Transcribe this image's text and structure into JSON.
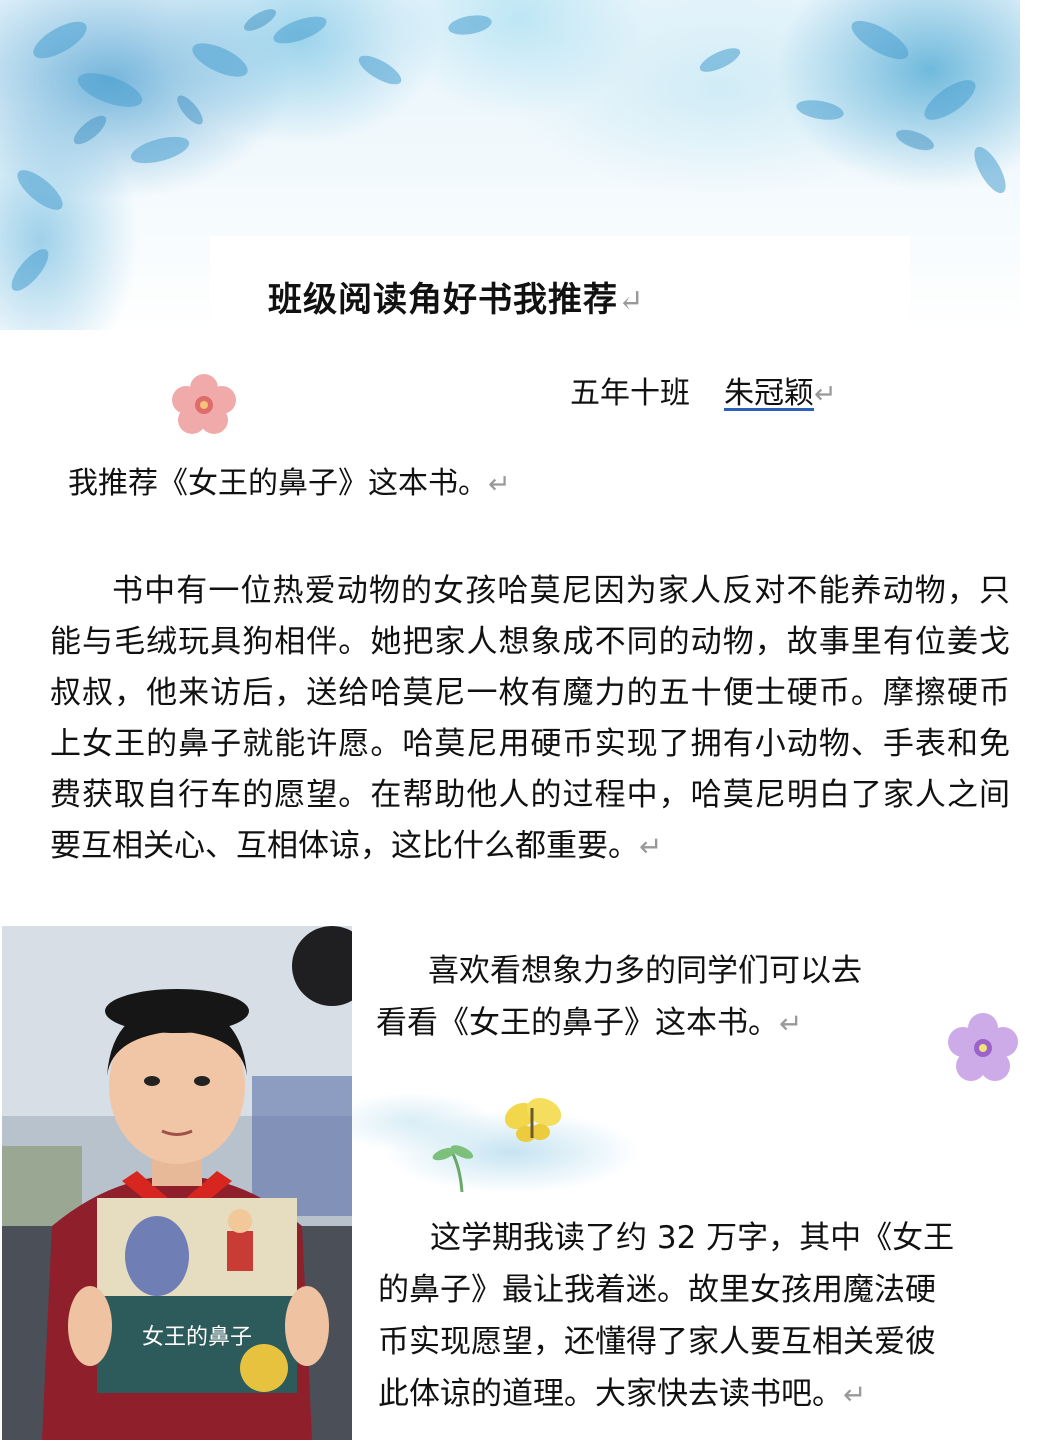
{
  "title": "班级阅读角好书我推荐",
  "return_mark": "↵",
  "author": {
    "class": "五年十班",
    "name": "朱冠颖"
  },
  "recommend_line": "我推荐《女王的鼻子》这本书。",
  "summary": "书中有一位热爱动物的女孩哈莫尼因为家人反对不能养动物，只能与毛绒玩具狗相伴。她把家人想象成不同的动物，故事里有位姜戈叔叔，他来访后，送给哈莫尼一枚有魔力的五十便士硬币。摩擦硬币上女王的鼻子就能许愿。哈莫尼用硬币实现了拥有小动物、手表和免费获取自行车的愿望。在帮助他人的过程中，哈莫尼明白了家人之间要互相关心、互相体谅，这比什么都重要。",
  "suggestion": {
    "line1": "喜欢看想象力多的同学们可以去",
    "line2": "看看《女王的鼻子》这本书。"
  },
  "reflection": {
    "line1": "这学期我读了约 32 万字，其中《女王",
    "line2": "的鼻子》最让我着迷。故里女孩用魔法硬",
    "line3": "币实现愿望，还懂得了家人要互相关爱彼",
    "line4": "此体谅的道理。大家快去读书吧。"
  },
  "book_cover": {
    "title_cn": "女王的鼻子"
  },
  "colors": {
    "leaf_blue": "#5aaad5",
    "flower_pink": "#e88a8a",
    "flower_purple": "#b48ad8",
    "butterfly_yellow": "#f2d64b"
  }
}
